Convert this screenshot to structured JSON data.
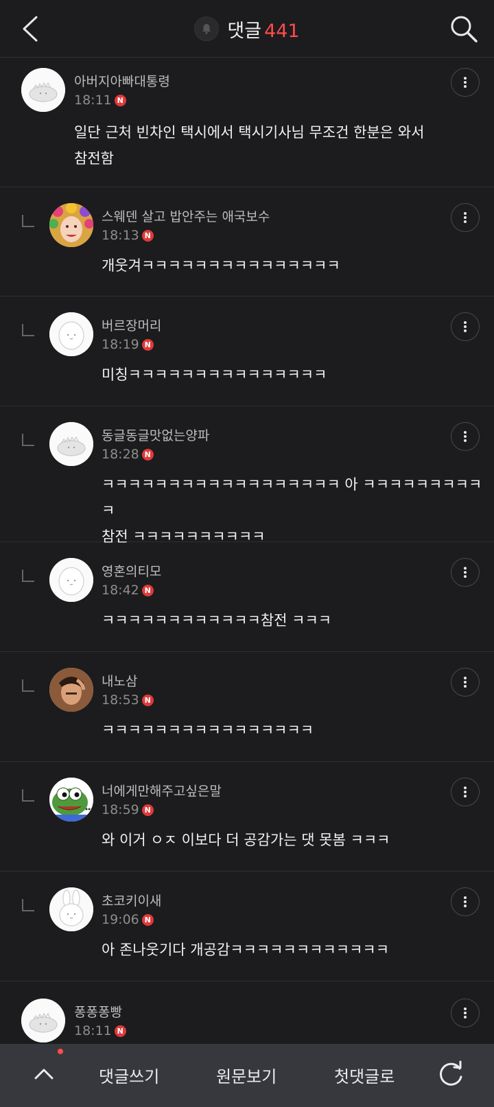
{
  "header": {
    "title": "댓글",
    "count": "441"
  },
  "comments": [
    {
      "nick": "아버지아빠대통령",
      "time": "18:11",
      "badge": "N",
      "body": "일단 근처 빈차인 택시에서 택시기사님 무조건 한분은 와서\n참전함",
      "reply": false
    },
    {
      "nick": "스웨덴 살고 밥안주는 애국보수",
      "time": "18:13",
      "badge": "N",
      "body": "개웃겨ㅋㅋㅋㅋㅋㅋㅋㅋㅋㅋㅋㅋㅋㅋㅋ",
      "reply": true
    },
    {
      "nick": "버르장머리",
      "time": "18:19",
      "badge": "N",
      "body": "미칭ㅋㅋㅋㅋㅋㅋㅋㅋㅋㅋㅋㅋㅋㅋㅋ",
      "reply": true
    },
    {
      "nick": "동글동글맛없는양파",
      "time": "18:28",
      "badge": "N",
      "body": "ㅋㅋㅋㅋㅋㅋㅋㅋㅋㅋㅋㅋㅋㅋㅋㅋㅋㅋ 아 ㅋㅋㅋㅋㅋㅋㅋㅋㅋㅋ\n참전 ㅋㅋㅋㅋㅋㅋㅋㅋㅋㅋ",
      "reply": true
    },
    {
      "nick": "영혼의티모",
      "time": "18:42",
      "badge": "N",
      "body": "ㅋㅋㅋㅋㅋㅋㅋㅋㅋㅋㅋㅋ참전 ㅋㅋㅋ",
      "reply": true
    },
    {
      "nick": "내노삼",
      "time": "18:53",
      "badge": "N",
      "body": "ㅋㅋㅋㅋㅋㅋㅋㅋㅋㅋㅋㅋㅋㅋㅋㅋ",
      "reply": true
    },
    {
      "nick": "너에게만해주고싶은말",
      "time": "18:59",
      "badge": "N",
      "body": "와 이거 ㅇㅈ 이보다 더 공감가는 댓 못봄 ㅋㅋㅋ",
      "reply": true
    },
    {
      "nick": "초코키이새",
      "time": "19:06",
      "badge": "N",
      "body": "아 존나웃기다 개공감ㅋㅋㅋㅋㅋㅋㅋㅋㅋㅋㅋㅋ",
      "reply": true
    },
    {
      "nick": "퐁퐁퐁빵",
      "time": "18:11",
      "badge": "N",
      "body": "",
      "reply": false
    }
  ],
  "bottom": {
    "write": "댓글쓰기",
    "original": "원문보기",
    "first": "첫댓글로"
  },
  "icons": {
    "back": "back-chevron-icon",
    "bell": "bell-icon",
    "search": "search-icon",
    "more": "more-vertical-icon",
    "up": "chevron-up-icon",
    "refresh": "refresh-icon"
  },
  "colors": {
    "accent": "#ff4b4b",
    "background": "#1c1c1e",
    "bottom_bar": "#36383d"
  }
}
